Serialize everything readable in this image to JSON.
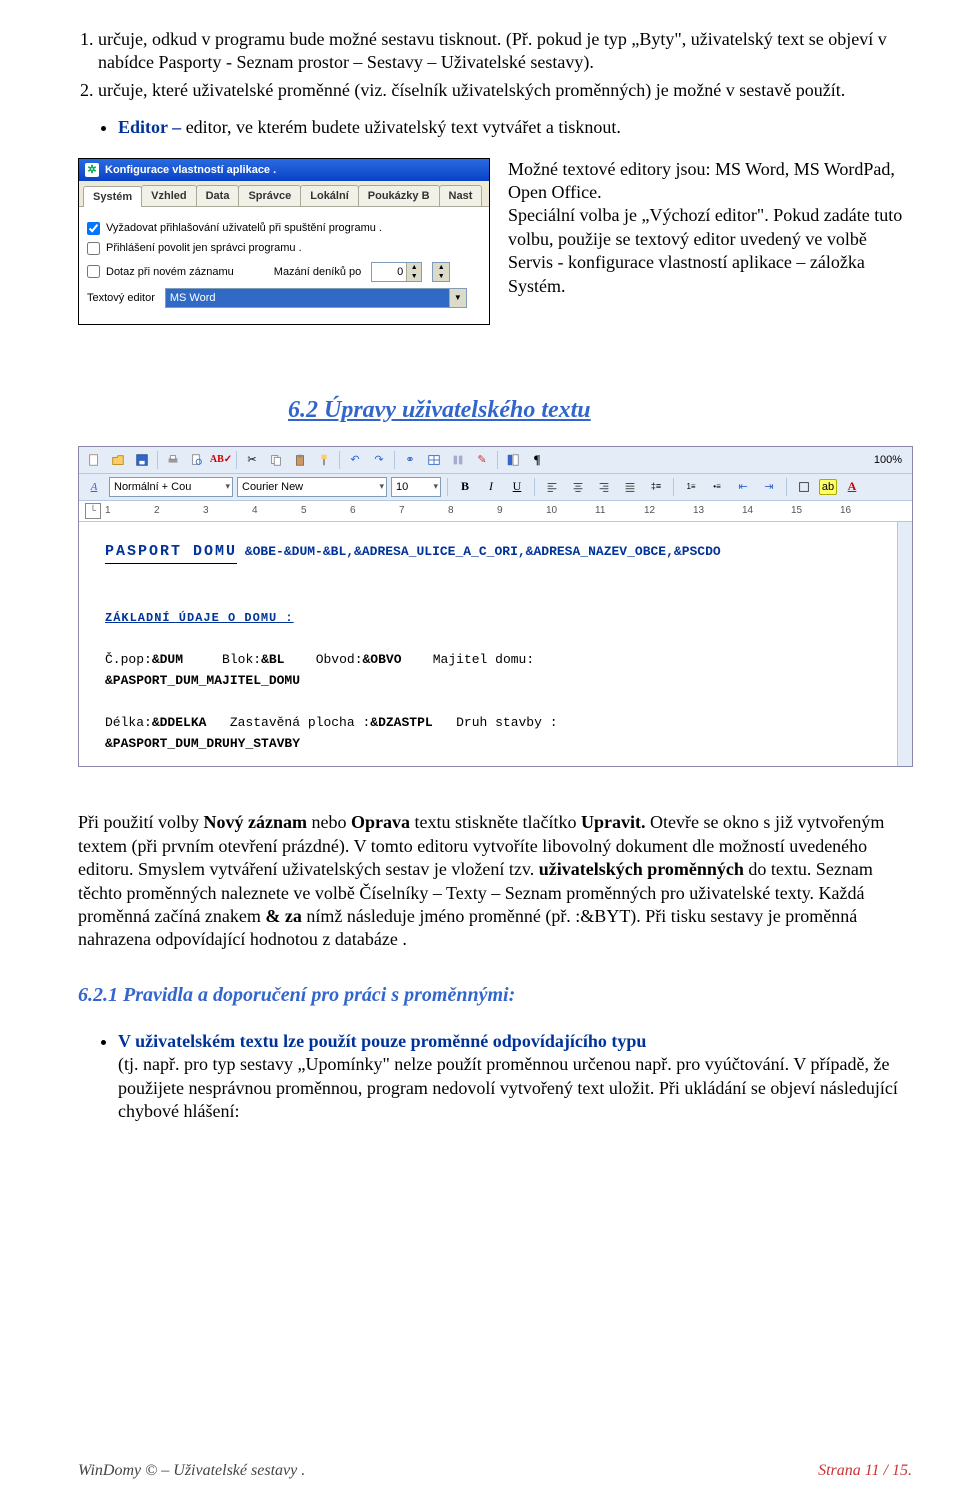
{
  "list1": [
    "určuje, odkud v programu bude možné sestavu tisknout. (Př. pokud je typ „Byty\", uživatelský text se objeví v nabídce Pasporty - Seznam prostor – Sestavy – Uživatelské sestavy).",
    "určuje, které uživatelské proměnné (viz. číselník uživatelských proměnných) je možné v sestavě použít."
  ],
  "editor_bullet_pre": "Editor – ",
  "editor_bullet": "editor, ve kterém budete uživatelský text vytvářet a tisknout.",
  "editors_p": "Možné textové editory jsou: MS Word, MS WordPad, Open Office.\nSpeciální volba je „Výchozí editor\". Pokud zadáte tuto volbu, použije se textový editor uvedený ve volbě Servis -  konfigurace vlastností aplikace – záložka Systém.",
  "cfg": {
    "title": "Konfigurace vlastností aplikace .",
    "tabs": [
      "Systém",
      "Vzhled",
      "Data",
      "Správce",
      "Lokální",
      "Poukázky B",
      "Nast"
    ],
    "chk1": "Vyžadovat přihlašování uživatelů při spuštění programu .",
    "chk2": "Přihlášení povolit jen správci programu .",
    "chk3": "Dotaz při novém záznamu",
    "delLabel": "Mazání deníků po",
    "delVal": "0",
    "editLabel": "Textový editor",
    "editVal": "MS Word"
  },
  "h2": "6.2   Úpravy uživatelského textu",
  "word": {
    "style": "Normální + Cou",
    "font": "Courier New",
    "size": "10",
    "zoom": "100%",
    "ruler": [
      "1",
      "2",
      "3",
      "4",
      "5",
      "6",
      "7",
      "8",
      "9",
      "10",
      "11",
      "12",
      "13",
      "14",
      "15",
      "16"
    ],
    "title": "PASPORT  DOMU",
    "titletail": "  &OBE-&DUM-&BL,&ADRESA_ULICE_A_C_ORI,&ADRESA_NAZEV_OBCE,&PSCDO",
    "sub": "ZÁKLADNÍ  ÚDAJE  O  DOMU :",
    "l1a": "Č.pop:",
    "l1b": "&DUM",
    "l1c": "Blok:",
    "l1d": "&BL",
    "l1e": "Obvod:",
    "l1f": "&OBVO",
    "l1g": "Majitel domu:",
    "l2": "&PASPORT_DUM_MAJITEL_DOMU",
    "l3a": "Délka:",
    "l3b": "&DDELKA",
    "l3c": "Zastavěná plocha :",
    "l3d": "&DZASTPL",
    "l3e": "Druh stavby :",
    "l4": "&PASPORT_DUM_DRUHY_STAVBY"
  },
  "para2_1": "Při použití volby ",
  "para2_2": "Nový záznam",
  "para2_3": " nebo ",
  "para2_4": "Oprava",
  "para2_5": " textu stiskněte tlačítko ",
  "para2_6": "Upravit.",
  "para2_7": " Otevře se okno s již vytvořeným textem (při prvním otevření prázdné). V tomto editoru vytvoříte libovolný dokument dle možností uvedeného editoru. Smyslem vytváření uživatelských sestav je vložení tzv. ",
  "para2_8": "uživatelských proměnných",
  "para2_9": " do textu. Seznam těchto proměnných naleznete ve volbě Číselníky – Texty – Seznam proměnných pro uživatelské texty. Každá proměnná začíná znakem  ",
  "para2_10": "& za",
  "para2_11": " nímž následuje jméno proměnné (př. :&BYT). Při tisku sestavy je proměnná nahrazena odpovídající hodnotou z databáze .",
  "h3": "6.2.1  Pravidla a doporučení pro práci s proměnnými:",
  "blue_rule": "V uživatelském textu lze použít pouze proměnné odpovídajícího typu",
  "rule_follow": " (tj. např. pro typ sestavy „Upomínky\" nelze použít proměnnou určenou např. pro vyúčtování. V případě, že použijete nesprávnou proměnnou, program nedovolí vytvořený text uložit. Při ukládání se objeví následující chybové hlášení:",
  "footL": "WinDomy ©  – Uživatelské sestavy .",
  "footR": "Strana 11 / 15."
}
